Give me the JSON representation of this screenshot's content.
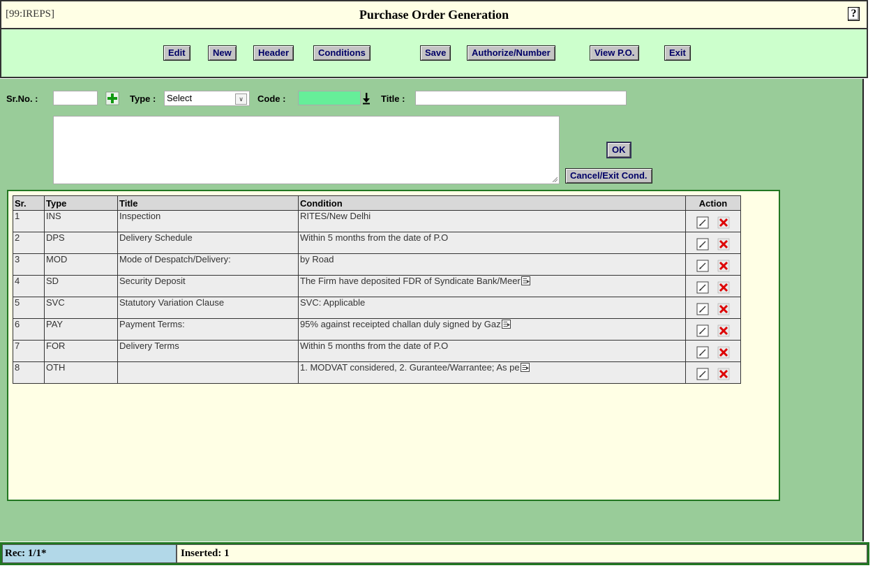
{
  "window": {
    "app_name": "[99:IREPS]",
    "title": "Purchase Order Generation",
    "help_label": "?"
  },
  "toolbar": {
    "buttons": [
      "Edit",
      "New",
      "Header",
      "Conditions",
      "Save",
      "Authorize/Number",
      "View P.O.",
      "Exit"
    ]
  },
  "form": {
    "srno_label": "Sr.No. :",
    "srno_value": "",
    "type_label": "Type :",
    "type_value": "Select",
    "code_label": "Code :",
    "code_value": "",
    "title_label": "Title :",
    "title_value": "",
    "condition_text": "",
    "ok_label": "OK",
    "cancel_label": "Cancel/Exit Cond."
  },
  "table": {
    "headers": [
      "Sr.",
      "Type",
      "Title",
      "Condition",
      "Action"
    ],
    "rows": [
      {
        "sr": "1",
        "type": "INS",
        "title": "Inspection",
        "condition": "RITES/New Delhi",
        "more": false
      },
      {
        "sr": "2",
        "type": "DPS",
        "title": "Delivery Schedule",
        "condition": "Within 5 months from the date of P.O",
        "more": false
      },
      {
        "sr": "3",
        "type": "MOD",
        "title": "Mode of Despatch/Delivery:",
        "condition": "by Road",
        "more": false
      },
      {
        "sr": "4",
        "type": "SD",
        "title": "Security Deposit",
        "condition": "The Firm have deposited FDR of Syndicate Bank/Meer",
        "more": true
      },
      {
        "sr": "5",
        "type": "SVC",
        "title": "Statutory Variation Clause",
        "condition": "SVC: Applicable",
        "more": false
      },
      {
        "sr": "6",
        "type": "PAY",
        "title": "Payment Terms:",
        "condition": "95% against receipted challan duly signed by Gaz",
        "more": true
      },
      {
        "sr": "7",
        "type": "FOR",
        "title": "Delivery Terms",
        "condition": "Within 5 months from the date of P.O",
        "more": false
      },
      {
        "sr": "8",
        "type": "OTH",
        "title": "",
        "condition": "1. MODVAT considered, 2. Gurantee/Warrantee; As pe",
        "more": true
      }
    ]
  },
  "status": {
    "record": "Rec: 1/1*",
    "message": "Inserted: 1"
  },
  "colors": {
    "title_bg": "#ffffe5",
    "toolbar_bg": "#ccffcc",
    "main_bg": "#99cc99",
    "code_field": "#66ee99",
    "delete_red": "#dd0000"
  },
  "icons": {
    "add": "plus-icon",
    "lookup": "down-arrow-icon",
    "more": "expand-text-icon",
    "edit": "edit-icon",
    "delete": "delete-icon"
  }
}
